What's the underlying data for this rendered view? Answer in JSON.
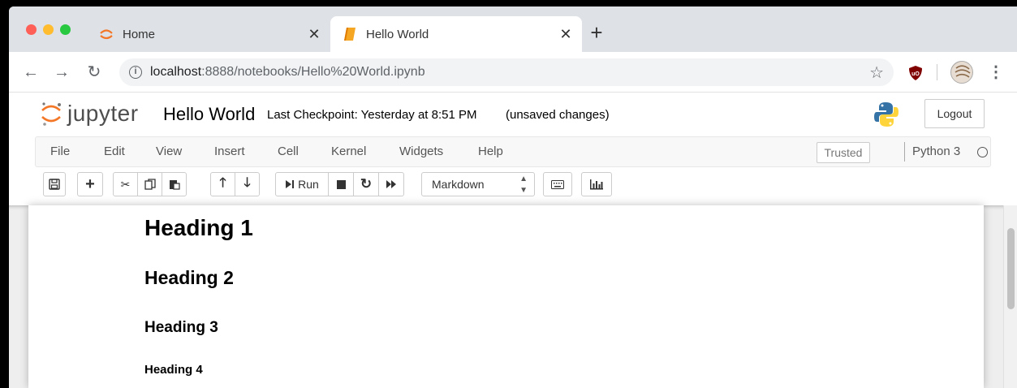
{
  "browser": {
    "tabs": [
      {
        "title": "Home",
        "active": false
      },
      {
        "title": "Hello World",
        "active": true
      }
    ],
    "new_tab_icon": "plus-icon",
    "url": {
      "host": "localhost",
      "path": ":8888/notebooks/Hello%20World.ipynb"
    }
  },
  "jupyter": {
    "logo_text": "jupyter",
    "notebook_name": "Hello World",
    "checkpoint": "Last Checkpoint: Yesterday at 8:51 PM",
    "save_status": "(unsaved changes)",
    "logout_label": "Logout",
    "menu": [
      "File",
      "Edit",
      "View",
      "Insert",
      "Cell",
      "Kernel",
      "Widgets",
      "Help"
    ],
    "trusted_label": "Trusted",
    "kernel_name": "Python 3",
    "run_label": "Run",
    "cell_type": "Markdown"
  },
  "notebook": {
    "headings": [
      "Heading 1",
      "Heading 2",
      "Heading 3",
      "Heading 4"
    ]
  },
  "colors": {
    "tabstrip": "#dee1e6",
    "jupyter_orange": "#f37726",
    "menubar_bg": "#f8f8f8",
    "notebook_bg": "#eeeeee"
  }
}
